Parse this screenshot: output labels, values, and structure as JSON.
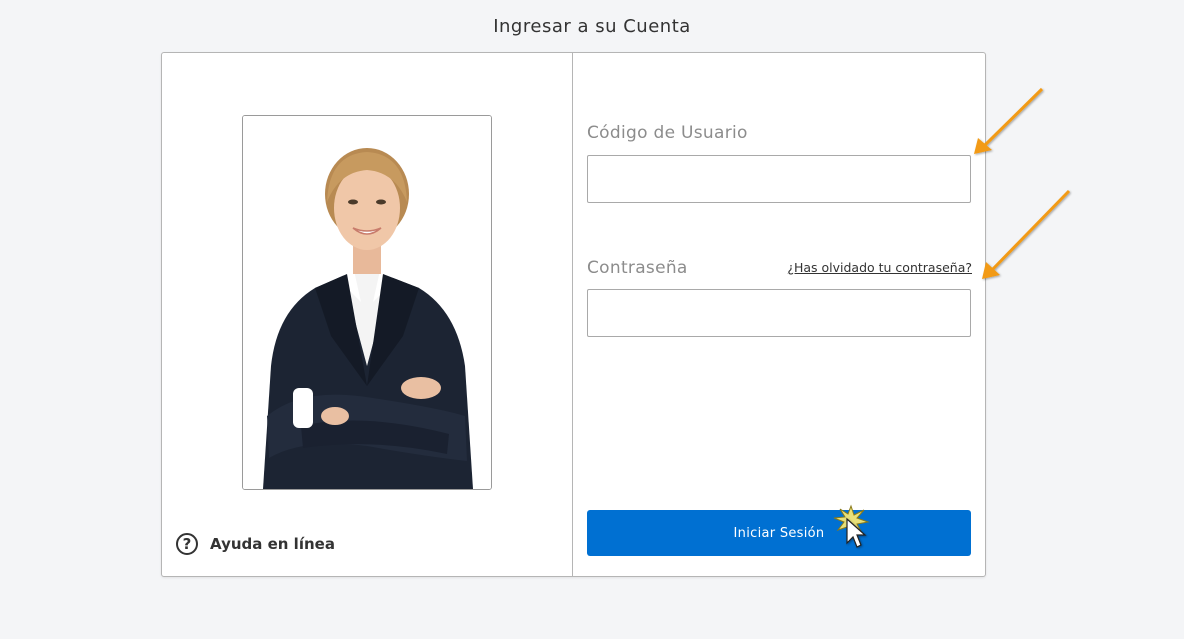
{
  "page": {
    "title": "Ingresar a su Cuenta"
  },
  "help": {
    "icon": "question-circle-icon",
    "glyph": "?",
    "label": "Ayuda en línea"
  },
  "form": {
    "username_label": "Código de Usuario",
    "username_value": "",
    "password_label": "Contraseña",
    "password_value": "",
    "forgot_link": "¿Has olvidado tu contraseña?",
    "submit_label": "Iniciar Sesión"
  },
  "colors": {
    "primary_button": "#0070d2",
    "annotation_arrow": "#f29a12",
    "background": "#f4f5f7"
  }
}
